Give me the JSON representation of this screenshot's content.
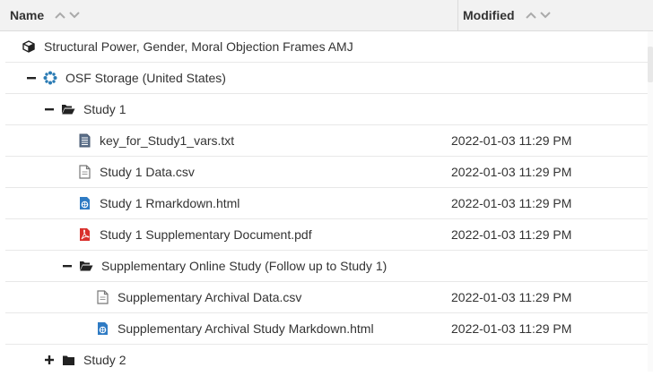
{
  "header": {
    "name_label": "Name",
    "modified_label": "Modified"
  },
  "rows": [
    {
      "name": "Structural Power, Gender, Moral Objection Frames AMJ",
      "modified": ""
    },
    {
      "name": "OSF Storage (United States)",
      "modified": ""
    },
    {
      "name": "Study 1",
      "modified": ""
    },
    {
      "name": "key_for_Study1_vars.txt",
      "modified": "2022-01-03 11:29 PM"
    },
    {
      "name": "Study 1 Data.csv",
      "modified": "2022-01-03 11:29 PM"
    },
    {
      "name": "Study 1 Rmarkdown.html",
      "modified": "2022-01-03 11:29 PM"
    },
    {
      "name": "Study 1 Supplementary Document.pdf",
      "modified": "2022-01-03 11:29 PM"
    },
    {
      "name": "Supplementary Online Study (Follow up to Study 1)",
      "modified": ""
    },
    {
      "name": "Supplementary Archival Data.csv",
      "modified": "2022-01-03 11:29 PM"
    },
    {
      "name": "Supplementary Archival Study Markdown.html",
      "modified": "2022-01-03 11:29 PM"
    },
    {
      "name": "Study 2",
      "modified": ""
    }
  ],
  "colors": {
    "pdf": "#d9302c",
    "html": "#2f7bc4",
    "osf": "#2a7bb4",
    "folder": "#222222"
  }
}
